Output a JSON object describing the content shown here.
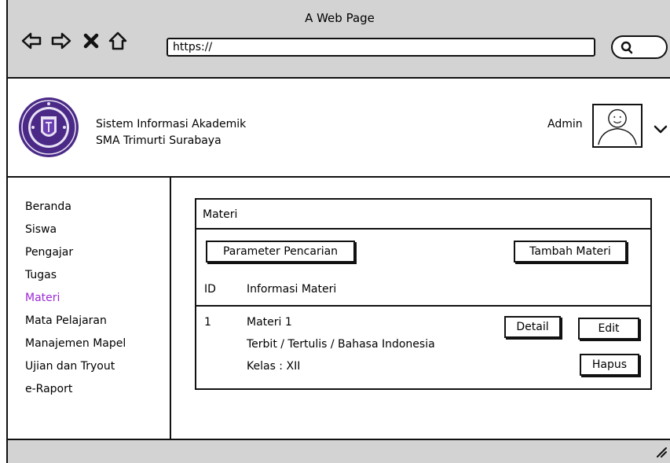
{
  "browser": {
    "window_title": "A Web Page",
    "url": "https://",
    "nav_icons": [
      "back-arrow-icon",
      "forward-arrow-icon",
      "close-x-icon",
      "home-icon"
    ]
  },
  "header": {
    "app_name_line1": "Sistem Informasi Akademik",
    "app_name_line2": "SMA Trimurti Surabaya",
    "user_name": "Admin"
  },
  "sidebar": {
    "items": [
      {
        "label": "Beranda"
      },
      {
        "label": "Siswa"
      },
      {
        "label": "Pengajar"
      },
      {
        "label": "Tugas"
      },
      {
        "label": "Materi",
        "active": true
      },
      {
        "label": "Mata Pelajaran"
      },
      {
        "label": "Manajemen Mapel"
      },
      {
        "label": "Ujian dan Tryout"
      },
      {
        "label": "e-Raport"
      }
    ],
    "active_color": "#9b27d6"
  },
  "panel": {
    "title": "Materi",
    "search_button": "Parameter Pencarian",
    "add_button": "Tambah Materi",
    "columns": {
      "id": "ID",
      "info": "Informasi Materi"
    },
    "rows": [
      {
        "id": "1",
        "name": "Materi 1",
        "publisher": "Terbit / Tertulis / Bahasa Indonesia",
        "class": "Kelas : XII",
        "detail_button": "Detail",
        "edit_button": "Edit",
        "delete_button": "Hapus"
      }
    ]
  }
}
